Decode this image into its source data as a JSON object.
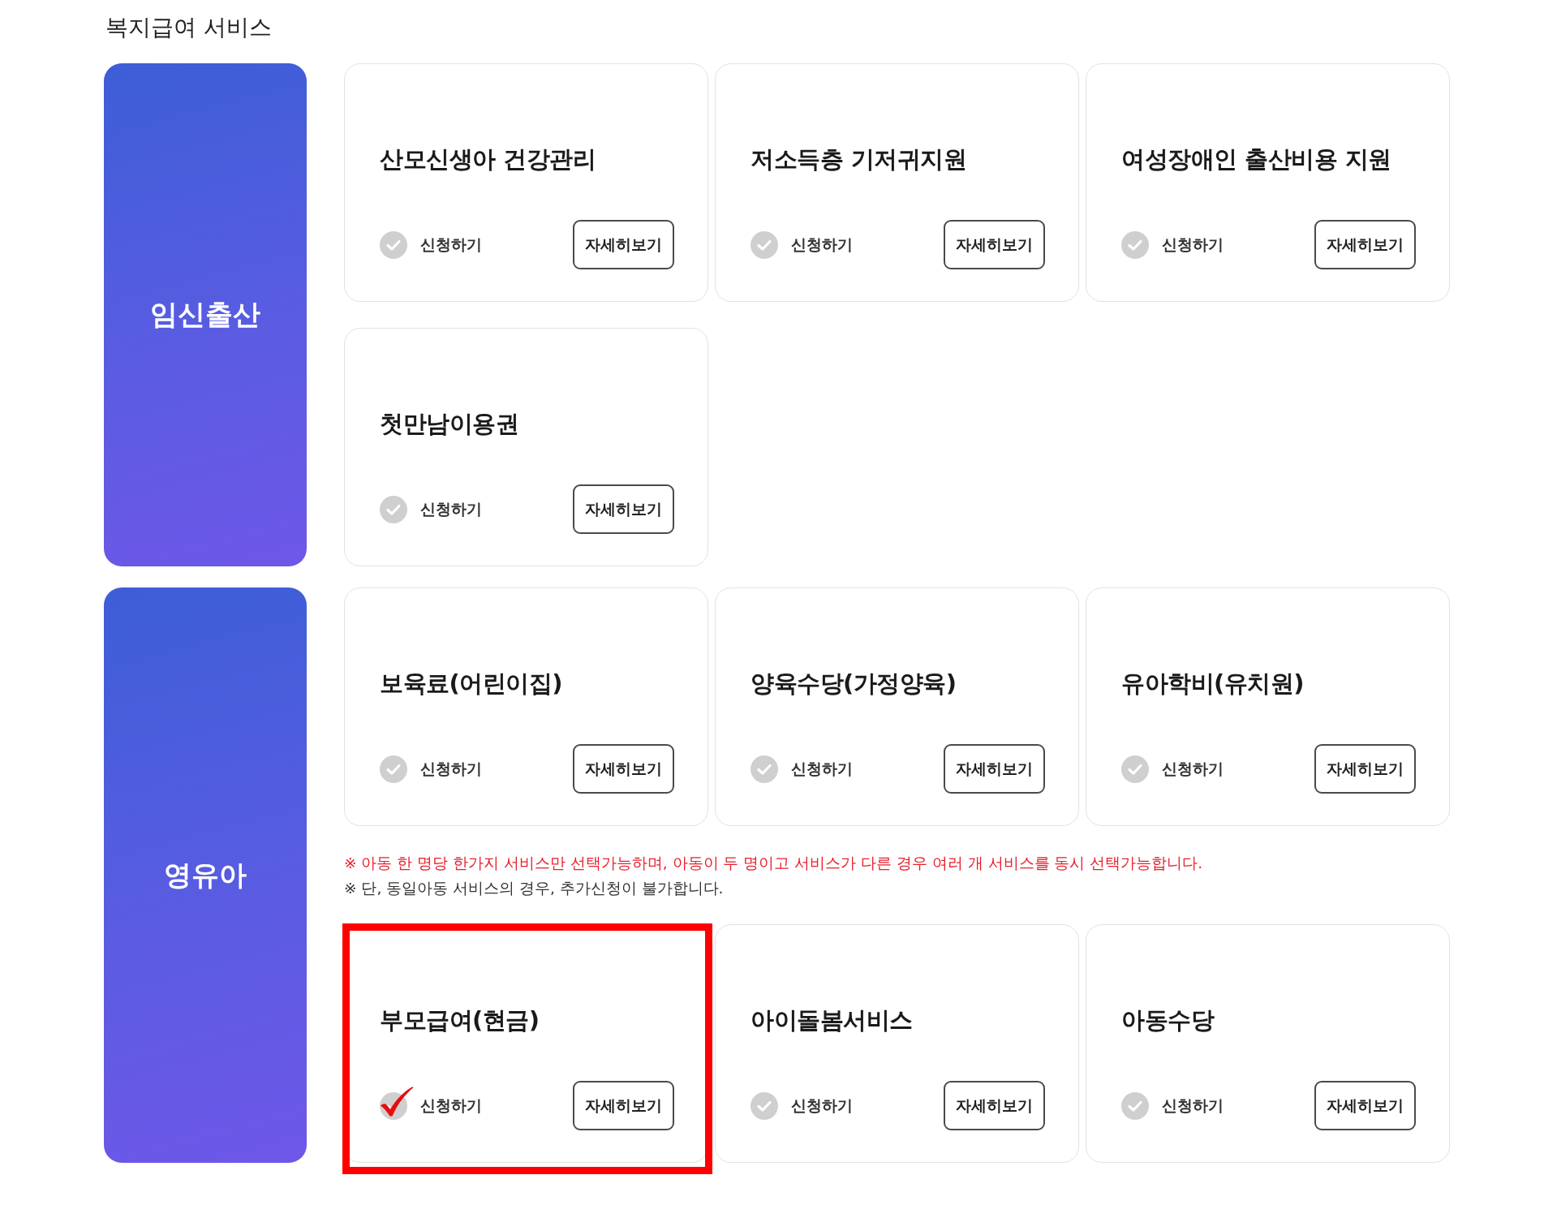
{
  "title": "복지급여 서비스",
  "sections": [
    {
      "category": "임신출산",
      "blocks": [
        {
          "kind": "cards",
          "cards": [
            {
              "title": "산모신생아 건강관리",
              "apply_label": "신청하기",
              "checked": false,
              "detail_button": "자세히보기",
              "highlighted": false
            },
            {
              "title": "저소득층 기저귀지원",
              "apply_label": "신청하기",
              "checked": false,
              "detail_button": "자세히보기",
              "highlighted": false
            },
            {
              "title": "여성장애인 출산비용 지원",
              "apply_label": "신청하기",
              "checked": false,
              "detail_button": "자세히보기",
              "highlighted": false
            },
            {
              "title": "첫만남이용권",
              "apply_label": "신청하기",
              "checked": false,
              "detail_button": "자세히보기",
              "highlighted": false
            }
          ]
        }
      ]
    },
    {
      "category": "영유아",
      "blocks": [
        {
          "kind": "cards",
          "cards": [
            {
              "title": "보육료(어린이집)",
              "apply_label": "신청하기",
              "checked": false,
              "detail_button": "자세히보기",
              "highlighted": false
            },
            {
              "title": "양육수당(가정양육)",
              "apply_label": "신청하기",
              "checked": false,
              "detail_button": "자세히보기",
              "highlighted": false
            },
            {
              "title": "유아학비(유치원)",
              "apply_label": "신청하기",
              "checked": false,
              "detail_button": "자세히보기",
              "highlighted": false
            }
          ]
        },
        {
          "kind": "notes",
          "lines": [
            {
              "text": "※ 아동 한 명당 한가지 서비스만 선택가능하며, 아동이 두 명이고 서비스가 다른 경우 여러 개 서비스를 동시 선택가능합니다.",
              "color": "#e8202e"
            },
            {
              "text": "※ 단, 동일아동 서비스의 경우, 추가신청이 불가합니다.",
              "color": "#333333"
            }
          ]
        },
        {
          "kind": "cards",
          "cards": [
            {
              "title": "부모급여(현금)",
              "apply_label": "신청하기",
              "checked": true,
              "detail_button": "자세히보기",
              "highlighted": true
            },
            {
              "title": "아이돌봄서비스",
              "apply_label": "신청하기",
              "checked": false,
              "detail_button": "자세히보기",
              "highlighted": false
            },
            {
              "title": "아동수당",
              "apply_label": "신청하기",
              "checked": false,
              "detail_button": "자세히보기",
              "highlighted": false
            }
          ]
        }
      ]
    }
  ]
}
